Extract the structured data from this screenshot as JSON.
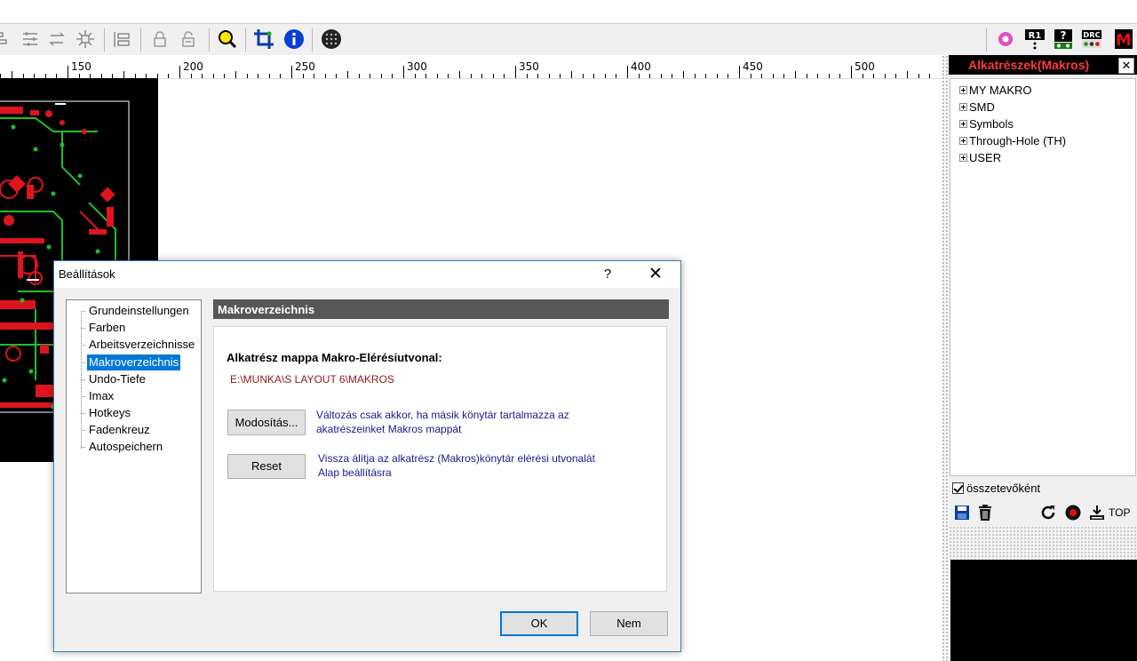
{
  "toolbar": {
    "icons": [
      "align-icon",
      "align-icon",
      "rotate-icon",
      "explode-icon",
      "properties-icon",
      "lock-icon",
      "unlock-icon",
      "zoom-icon",
      "crop-icon",
      "info-icon",
      "grid-icon",
      "pad-icon",
      "r1-icon",
      "help-icon",
      "drc-icon",
      "macro-icon"
    ],
    "r1_label": "R1",
    "drc_label": "DRC"
  },
  "ruler": {
    "labels": [
      "150",
      "200",
      "250",
      "300",
      "350",
      "400",
      "450",
      "500"
    ]
  },
  "panel": {
    "title": "Alkatrészek(Makros)",
    "close_glyph": "✕",
    "tree": [
      {
        "label": "MY MAKRO"
      },
      {
        "label": "SMD"
      },
      {
        "label": "Symbols"
      },
      {
        "label": "Through-Hole (TH)"
      },
      {
        "label": "USER"
      }
    ],
    "checkbox_label": "összetevőként",
    "checkbox_checked": true,
    "top_label": "TOP"
  },
  "dialog": {
    "title": "Beállítások",
    "help_glyph": "?",
    "close_glyph": "✕",
    "nav": [
      {
        "label": "Grundeinstellungen"
      },
      {
        "label": "Farben"
      },
      {
        "label": "Arbeitsverzeichnisse"
      },
      {
        "label": "Makroverzeichnis",
        "selected": true
      },
      {
        "label": "Undo-Tiefe"
      },
      {
        "label": "Imax"
      },
      {
        "label": "Hotkeys"
      },
      {
        "label": "Fadenkreuz"
      },
      {
        "label": "Autospeichern"
      }
    ],
    "section_header": "Makroverzeichnis",
    "path_label": "Alkatrész mappa Makro-Elérésiutvonal:",
    "path_value": "E:\\MUNKA\\S LAYOUT 6\\MAKROS",
    "modify_button": "Modosítás...",
    "modify_desc_1": "Változás csak akkor, ha másik könytár tartalmazza az",
    "modify_desc_2": "akatrészeinket Makros mappát",
    "reset_button": "Reset",
    "reset_desc_1": "Vissza álítja az alkatrész (Makros)könytár elérési utvonalát",
    "reset_desc_2": "Alap beállításra",
    "ok_button": "OK",
    "cancel_button": "Nem"
  },
  "colors": {
    "accent": "#0078d7",
    "panel_title": "#ff3b3b",
    "path_value": "#8b1a1a",
    "desc_text": "#1a1a8c",
    "pcb_red": "#e0141e",
    "pcb_green": "#1fbf2c"
  }
}
